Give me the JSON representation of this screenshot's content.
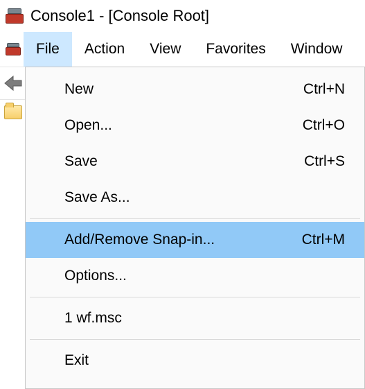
{
  "window": {
    "title": "Console1 - [Console Root]"
  },
  "menubar": {
    "items": [
      {
        "label": "File",
        "open": true
      },
      {
        "label": "Action"
      },
      {
        "label": "View"
      },
      {
        "label": "Favorites"
      },
      {
        "label": "Window"
      }
    ]
  },
  "file_menu": {
    "new": {
      "label": "New",
      "shortcut": "Ctrl+N"
    },
    "open": {
      "label": "Open...",
      "shortcut": "Ctrl+O"
    },
    "save": {
      "label": "Save",
      "shortcut": "Ctrl+S"
    },
    "save_as": {
      "label": "Save As...",
      "shortcut": ""
    },
    "snapin": {
      "label": "Add/Remove Snap-in...",
      "shortcut": "Ctrl+M"
    },
    "options": {
      "label": "Options...",
      "shortcut": ""
    },
    "recent1": {
      "label": "1 wf.msc",
      "shortcut": ""
    },
    "exit": {
      "label": "Exit",
      "shortcut": ""
    }
  }
}
